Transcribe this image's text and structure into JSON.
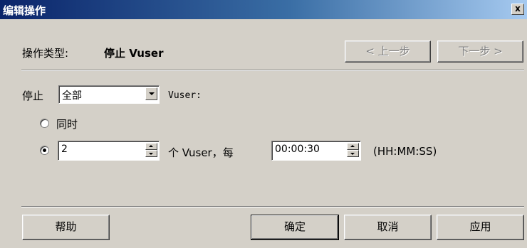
{
  "window": {
    "title": "编辑操作",
    "close_label": "x"
  },
  "header": {
    "operation_type_label": "操作类型:",
    "operation_type_value": "停止 Vuser",
    "prev_button": "< 上一步",
    "next_button": "下一步 >"
  },
  "stop_row": {
    "label": "停止",
    "select_value": "全部",
    "suffix": "Vuser:"
  },
  "options": {
    "simultaneous_label": "同时",
    "simultaneous_checked": false,
    "gradual_checked": true,
    "count_value": "2",
    "per_label": "个 Vuser，每",
    "interval_value": "00:00:30",
    "format_hint": "(HH:MM:SS)"
  },
  "footer": {
    "help_button": "帮助",
    "ok_button": "确定",
    "cancel_button": "取消",
    "apply_button": "应用"
  }
}
